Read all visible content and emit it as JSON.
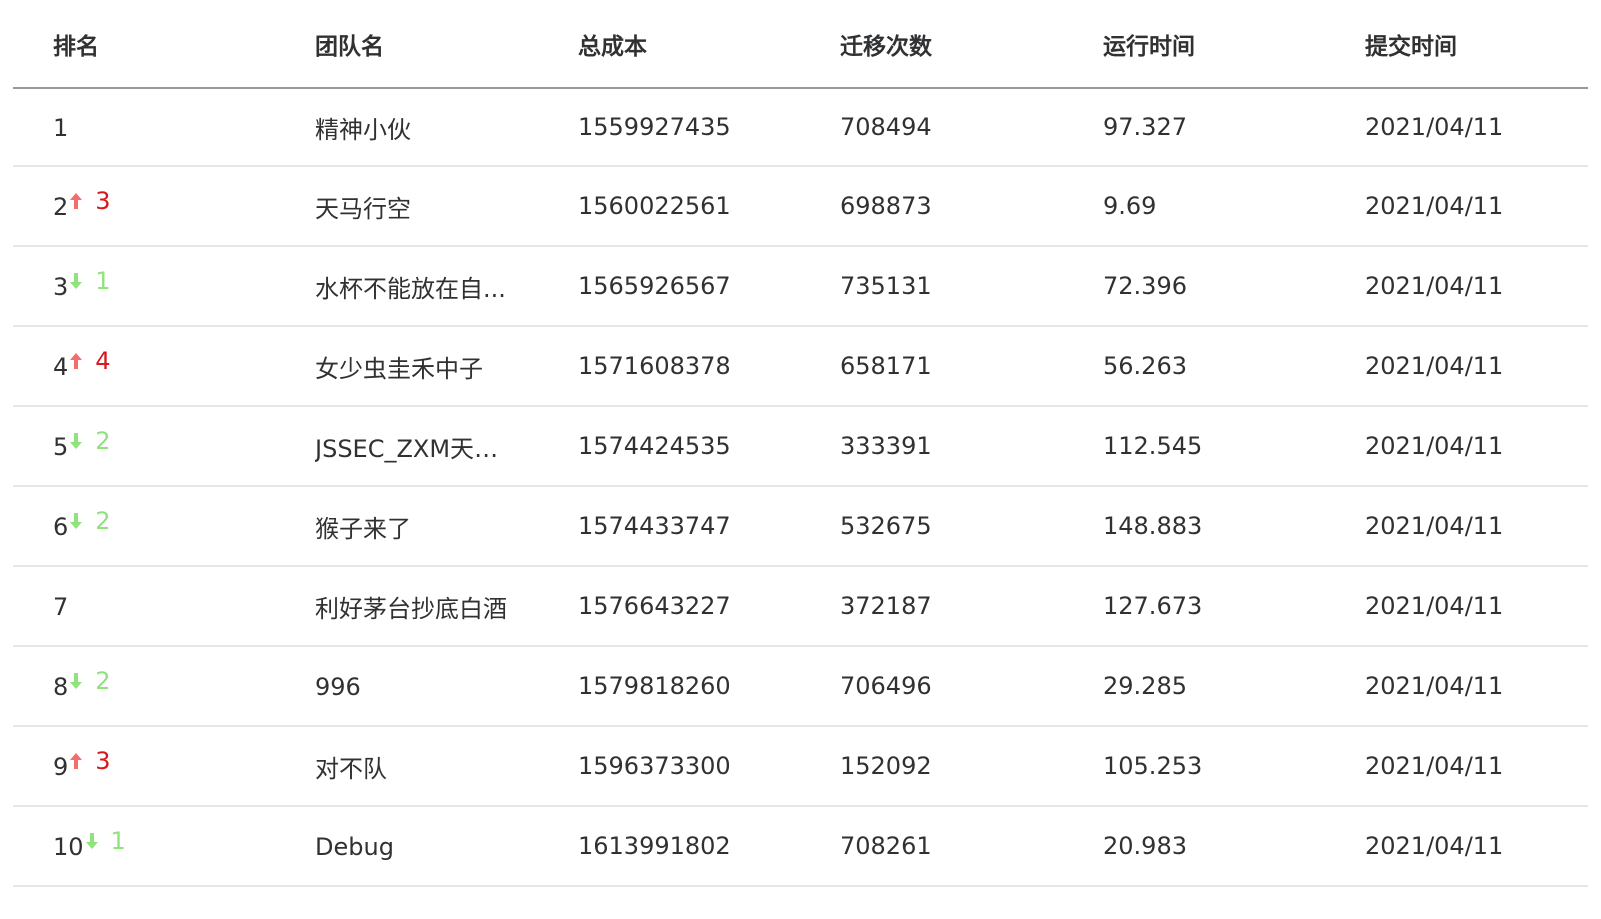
{
  "table": {
    "headers": [
      "排名",
      "团队名",
      "总成本",
      "迁移次数",
      "运行时间",
      "提交时间"
    ],
    "rows": [
      {
        "rank": "1",
        "trend": "none",
        "change": "",
        "team": "精神小伙",
        "cost": "1559927435",
        "migrations": "708494",
        "runtime": "97.327",
        "date": "2021/04/11"
      },
      {
        "rank": "2",
        "trend": "up",
        "change": "3",
        "team": "天马行空",
        "cost": "1560022561",
        "migrations": "698873",
        "runtime": "9.69",
        "date": "2021/04/11"
      },
      {
        "rank": "3",
        "trend": "down",
        "change": "1",
        "team": "水杯不能放在自...",
        "cost": "1565926567",
        "migrations": "735131",
        "runtime": "72.396",
        "date": "2021/04/11"
      },
      {
        "rank": "4",
        "trend": "up",
        "change": "4",
        "team": "女少虫圭禾中子",
        "cost": "1571608378",
        "migrations": "658171",
        "runtime": "56.263",
        "date": "2021/04/11"
      },
      {
        "rank": "5",
        "trend": "down",
        "change": "2",
        "team": "JSSEC_ZXM天下...",
        "cost": "1574424535",
        "migrations": "333391",
        "runtime": "112.545",
        "date": "2021/04/11"
      },
      {
        "rank": "6",
        "trend": "down",
        "change": "2",
        "team": "猴子来了",
        "cost": "1574433747",
        "migrations": "532675",
        "runtime": "148.883",
        "date": "2021/04/11"
      },
      {
        "rank": "7",
        "trend": "none",
        "change": "",
        "team": "利好茅台抄底白酒",
        "cost": "1576643227",
        "migrations": "372187",
        "runtime": "127.673",
        "date": "2021/04/11"
      },
      {
        "rank": "8",
        "trend": "down",
        "change": "2",
        "team": "996",
        "cost": "1579818260",
        "migrations": "706496",
        "runtime": "29.285",
        "date": "2021/04/11"
      },
      {
        "rank": "9",
        "trend": "up",
        "change": "3",
        "team": "对不队",
        "cost": "1596373300",
        "migrations": "152092",
        "runtime": "105.253",
        "date": "2021/04/11"
      },
      {
        "rank": "10",
        "trend": "down",
        "change": "1",
        "team": "Debug",
        "cost": "1613991802",
        "migrations": "708261",
        "runtime": "20.983",
        "date": "2021/04/11"
      }
    ]
  },
  "colors": {
    "up_arrow": "#f56c6c",
    "up_text": "#d7191c",
    "down_arrow": "#8fe37d",
    "down_text": "#8fe37d",
    "text": "#303133",
    "header_border": "#999999",
    "row_border": "#e6e6e6"
  },
  "icons": {
    "up": "arrow-up-icon",
    "down": "arrow-down-icon"
  }
}
